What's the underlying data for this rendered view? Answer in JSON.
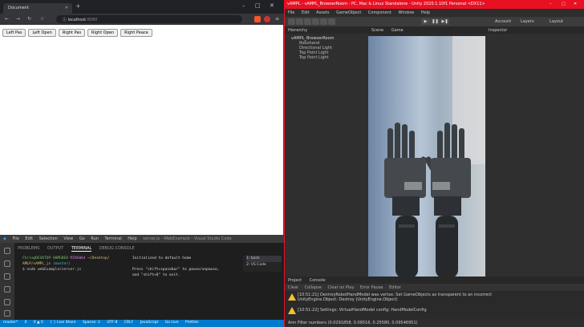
{
  "browser": {
    "tab_title": "Document",
    "new_tab_icon": "plus-icon",
    "url_host": "localhost",
    "url_port": ":8080",
    "buttons": [
      "Left Pas",
      "Left Open",
      "Right Pas",
      "Right Open",
      "Right Peace"
    ]
  },
  "vscode": {
    "menu": [
      "File",
      "Edit",
      "Selection",
      "View",
      "Go",
      "Run",
      "Terminal",
      "Help"
    ],
    "menu_tail": "server.js - WebExample - Visual Studio Code",
    "panel_tabs": [
      "PROBLEMS",
      "OUTPUT",
      "TERMINAL",
      "DEBUG CONSOLE"
    ],
    "terminal_left": {
      "prompt_user": "Chris@DESKTOP-SKMGBE8",
      "prompt_env": "MINGW64",
      "prompt_path": "~/Desktop/",
      "path_line": "AMLP/vAMPL_js",
      "branch": "(master)",
      "command": "$ node webExample/server.js"
    },
    "terminal_right": {
      "line1": "Initialized to default home",
      "line2": "Press \"shift+spacebar\" to pause/unpause,",
      "line3": "and \"shift+Q\" to exit."
    },
    "terminal_list": [
      "1: bash",
      "2: VS Code"
    ],
    "status": [
      "master*",
      "0",
      "0 ▲ 0",
      "{ } Live Share",
      "Spaces: 2",
      "UTF-8",
      "CRLF",
      "JavaScript",
      "Go Live",
      "Prettier"
    ]
  },
  "unity": {
    "title": "vAMPL - vAMPL_BrowserRoom - PC, Mac & Linux Standalone - Unity 2020.1.10f1 Personal <DX11>",
    "menu": [
      "File",
      "Edit",
      "Assets",
      "GameObject",
      "Component",
      "Window",
      "Help"
    ],
    "toolbar_right": [
      "Account",
      "Layers",
      "Layout"
    ],
    "hierarchy_tab": "Hierarchy",
    "hierarchy_items": [
      "vAMPL_BrowserRoom",
      "Robohand",
      "Directional Light",
      "Top Point Light",
      "Top Point Light"
    ],
    "scene_tabs": [
      "Scene",
      "Game"
    ],
    "scene_labels": [
      "Shaded",
      "2D"
    ],
    "inspector_tab": "Inspector",
    "console_tabs": [
      "Project",
      "Console"
    ],
    "console_tools": [
      "Clear",
      "Collapse",
      "Clear on Play",
      "Error Pause",
      "Editor"
    ],
    "warnings": [
      "[10:51:21] DestroyRobotHandModel was vertex: Set GameObjects as transparent to an incorrect",
      "UnityEngine.Object: Destroy (UnityEngine.Object)",
      "[10:51:22] Settings: VirtualHandModel config: HandModelConfig"
    ],
    "status": "Arm Filter numbers (0.0291858, 0.09516, 0.25580, 0.09546951)"
  }
}
